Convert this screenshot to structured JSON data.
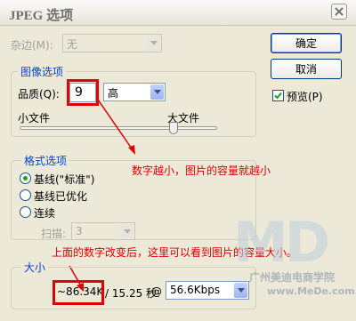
{
  "window": {
    "title": "JPEG 选项"
  },
  "matte": {
    "label": "杂边(M):",
    "value": "无"
  },
  "image_options": {
    "legend": "图像选项",
    "quality_label": "品质(Q):",
    "quality_value": "9",
    "quality_level": "高",
    "small_file_label": "小文件",
    "large_file_label": "大文件",
    "slider_level": 0.78
  },
  "format_options": {
    "legend": "格式选项",
    "radios": [
      {
        "label": "基线(\"标准\")",
        "selected": true
      },
      {
        "label": "基线已优化",
        "selected": false
      },
      {
        "label": "连续",
        "selected": false
      }
    ],
    "scans_label": "扫描:",
    "scans_value": "3"
  },
  "size": {
    "legend": "大小",
    "file_size": "~86.34K",
    "time": "/ 15.25 秒",
    "at": "@",
    "speed": "56.6Kbps"
  },
  "buttons": {
    "ok": "确定",
    "cancel": "取消"
  },
  "preview": {
    "label": "预览(P)",
    "checked": true
  },
  "annotations": {
    "note1": "数字越小，图片的容量就越小",
    "note2": "上面的数字改变后，这里可以看到图片的容量大小。",
    "color": "#e00000"
  },
  "watermark": {
    "logo": "MD",
    "name": "广州美迪电商学院",
    "url": "www.MeDe.com.cn"
  }
}
